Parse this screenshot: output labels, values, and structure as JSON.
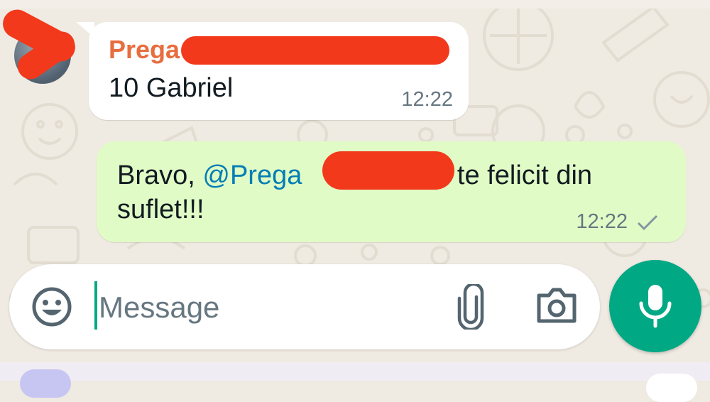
{
  "chat": {
    "messages": [
      {
        "direction": "incoming",
        "sender": "Prega",
        "text": "10 Gabriel",
        "time": "12:22",
        "sender_color": "#e86d3e"
      },
      {
        "direction": "outgoing",
        "text_before": "Bravo, ",
        "mention": "@Prega",
        "text_after": " te felicit din suflet!!!",
        "time": "12:22",
        "status_icon": "single-check-icon"
      }
    ]
  },
  "composer": {
    "placeholder": "Message",
    "icons": {
      "emoji": "smiley-icon",
      "attach": "paperclip-icon",
      "camera": "camera-icon",
      "voice": "microphone-icon"
    }
  },
  "colors": {
    "wallpaper": "#efeae2",
    "outgoing_bubble": "#e1fbc6",
    "incoming_bubble": "#ffffff",
    "accent": "#00a884",
    "mention": "#027eb5",
    "redaction": "#f2391b"
  }
}
